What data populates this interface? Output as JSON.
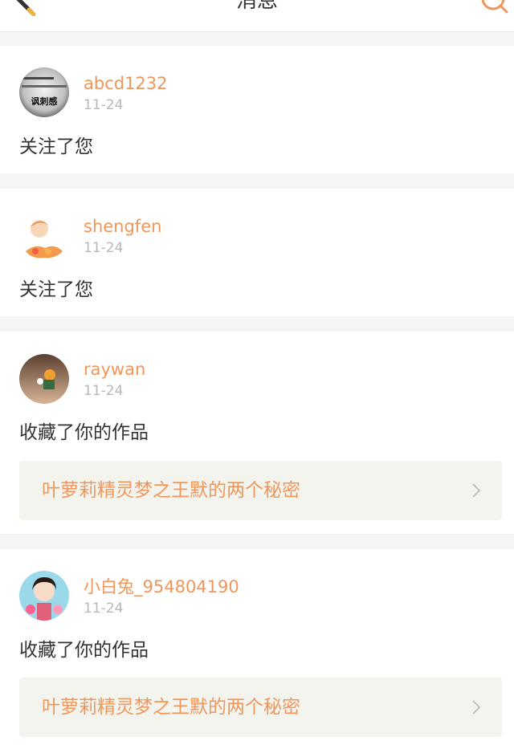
{
  "header": {
    "title": "消息",
    "left_icon": "pencil-icon",
    "right_icon": "search-icon"
  },
  "colors": {
    "accent": "#f0965a",
    "background": "#f5f5f5",
    "card": "#ffffff",
    "work_link_bg": "#f4f4ef",
    "date": "#b8b8b8",
    "text": "#333333"
  },
  "messages": [
    {
      "username": "abcd1232",
      "date": "11-24",
      "action": "关注了您",
      "avatar_text": "讽刺感"
    },
    {
      "username": "shengfen",
      "date": "11-24",
      "action": "关注了您"
    },
    {
      "username": "raywan",
      "date": "11-24",
      "action": "收藏了你的作品",
      "work_title": "叶萝莉精灵梦之王默的两个秘密"
    },
    {
      "username": "小白兔_954804190",
      "date": "11-24",
      "action": "收藏了你的作品",
      "work_title": "叶萝莉精灵梦之王默的两个秘密"
    }
  ]
}
